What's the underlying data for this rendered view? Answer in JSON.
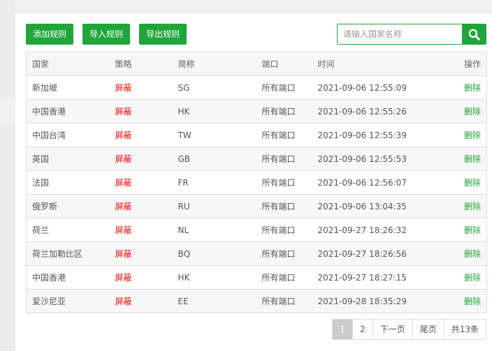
{
  "toolbar": {
    "add_label": "添加规则",
    "import_label": "导入规则",
    "export_label": "导出规则"
  },
  "search": {
    "placeholder": "请输入国家名称",
    "value": ""
  },
  "table": {
    "headers": {
      "country": "国家",
      "policy": "策略",
      "abbr": "简称",
      "port": "端口",
      "time": "时间",
      "action": "操作"
    },
    "rows": [
      {
        "country": "新加坡",
        "policy": "屏蔽",
        "abbr": "SG",
        "port": "所有端口",
        "time": "2021-09-06 12:55:09",
        "action": "删除"
      },
      {
        "country": "中国香港",
        "policy": "屏蔽",
        "abbr": "HK",
        "port": "所有端口",
        "time": "2021-09-06 12:55:26",
        "action": "删除"
      },
      {
        "country": "中国台湾",
        "policy": "屏蔽",
        "abbr": "TW",
        "port": "所有端口",
        "time": "2021-09-06 12:55:39",
        "action": "删除"
      },
      {
        "country": "英国",
        "policy": "屏蔽",
        "abbr": "GB",
        "port": "所有端口",
        "time": "2021-09-06 12:55:53",
        "action": "删除"
      },
      {
        "country": "法国",
        "policy": "屏蔽",
        "abbr": "FR",
        "port": "所有端口",
        "time": "2021-09-06 12:56:07",
        "action": "删除"
      },
      {
        "country": "俄罗斯",
        "policy": "屏蔽",
        "abbr": "RU",
        "port": "所有端口",
        "time": "2021-09-06 13:04:35",
        "action": "删除"
      },
      {
        "country": "荷兰",
        "policy": "屏蔽",
        "abbr": "NL",
        "port": "所有端口",
        "time": "2021-09-27 18:26:32",
        "action": "删除"
      },
      {
        "country": "荷兰加勒比区",
        "policy": "屏蔽",
        "abbr": "BQ",
        "port": "所有端口",
        "time": "2021-09-27 18:26:56",
        "action": "删除"
      },
      {
        "country": "中国香港",
        "policy": "屏蔽",
        "abbr": "HK",
        "port": "所有端口",
        "time": "2021-09-27 18:27:15",
        "action": "删除"
      },
      {
        "country": "爱沙尼亚",
        "policy": "屏蔽",
        "abbr": "EE",
        "port": "所有端口",
        "time": "2021-09-28 18:35:29",
        "action": "删除"
      }
    ]
  },
  "pagination": {
    "page1": "1",
    "page2": "2",
    "next": "下一页",
    "last": "尾页",
    "total": "共13条"
  },
  "colors": {
    "accent": "#20a53a",
    "policy": "#ef0808",
    "active_page": "#cccccc"
  },
  "icons": {
    "search": "search-icon"
  }
}
